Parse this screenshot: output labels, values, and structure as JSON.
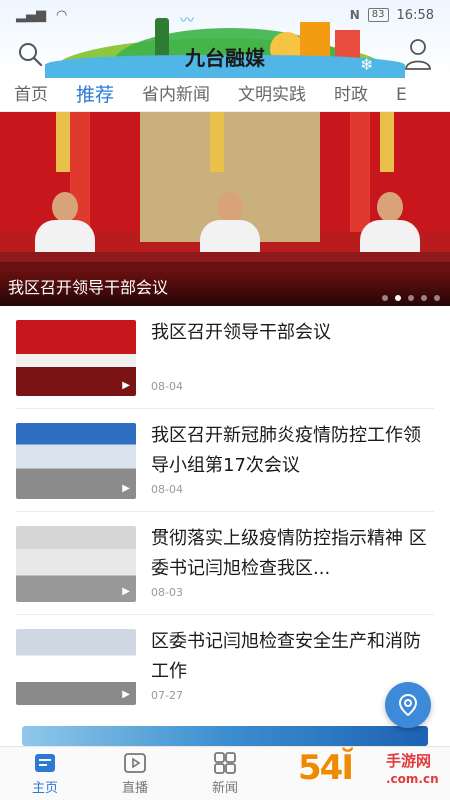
{
  "status_bar": {
    "time": "16:58",
    "battery": "83",
    "nfc": "N"
  },
  "header": {
    "title": "九台融媒"
  },
  "tabs": [
    "首页",
    "推荐",
    "省内新闻",
    "文明实践",
    "时政",
    "E"
  ],
  "active_tab": 1,
  "hero": {
    "caption": "我区召开领导干部会议",
    "slide_count": 5,
    "active_slide": 1
  },
  "news": [
    {
      "title": "我区召开领导干部会议",
      "date": "08-04"
    },
    {
      "title": "我区召开新冠肺炎疫情防控工作领导小组第17次会议",
      "date": "08-04"
    },
    {
      "title": "贯彻落实上级疫情防控指示精神 区委书记闫旭检查我区...",
      "date": "08-03"
    },
    {
      "title": "区委书记闫旭检查安全生产和消防工作",
      "date": "07-27"
    }
  ],
  "bottom_nav": [
    {
      "label": "主页",
      "icon": "home-icon"
    },
    {
      "label": "直播",
      "icon": "video-icon"
    },
    {
      "label": "新闻",
      "icon": "grid-icon"
    }
  ],
  "active_nav": 0,
  "watermark": {
    "big": "54Ĭ",
    "line1": "手游网",
    "line2": ".com.cn"
  },
  "colors": {
    "accent": "#2d7ad6",
    "fab": "#3d8ad9"
  }
}
